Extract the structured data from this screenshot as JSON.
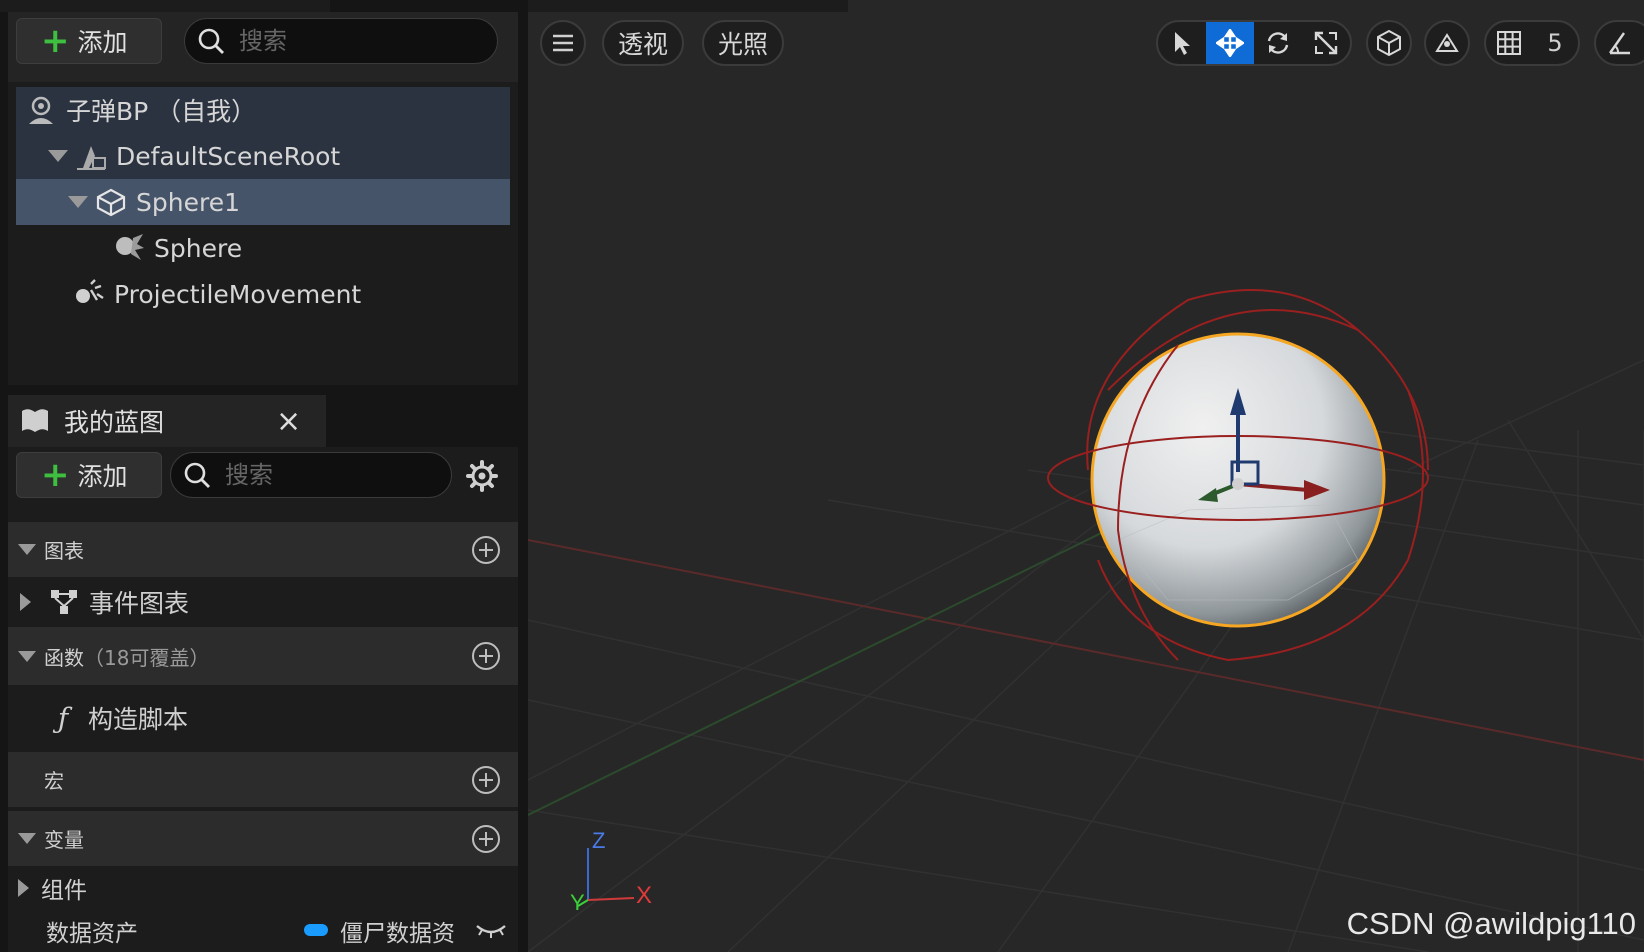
{
  "components": {
    "add_label": "添加",
    "search_placeholder": "搜索",
    "tree": [
      {
        "label": "子弹BP （自我）"
      },
      {
        "label": "DefaultSceneRoot"
      },
      {
        "label": "Sphere1"
      },
      {
        "label": "Sphere"
      },
      {
        "label": "ProjectileMovement"
      }
    ]
  },
  "my_blueprint": {
    "tab_title": "我的蓝图",
    "close_glyph": "×",
    "add_label": "添加",
    "search_placeholder": "搜索",
    "sections": {
      "graphs": "图表",
      "event_graph": "事件图表",
      "functions": "函数",
      "functions_count": "（18可覆盖）",
      "construction_script": "构造脚本",
      "macros": "宏",
      "variables": "变量",
      "components": "组件",
      "data_asset_name": "数据资产",
      "data_asset_type": "僵尸数据资"
    },
    "colors": {
      "variable_pill": "#1a9bff",
      "add_plus": "#3fbf3f"
    }
  },
  "viewport": {
    "menu_icon": "hamburger-icon",
    "perspective_label": "透视",
    "lighting_label": "光照",
    "grid_snap_value": "5",
    "active_tool": "translate",
    "axis_labels": {
      "x": "X",
      "y": "Y",
      "z": "Z"
    },
    "colors": {
      "active_tool": "#0f6cd6",
      "selection_outline": "#f5a623",
      "collision": "#9a1f1f"
    }
  },
  "watermark": "CSDN @awildpig110"
}
